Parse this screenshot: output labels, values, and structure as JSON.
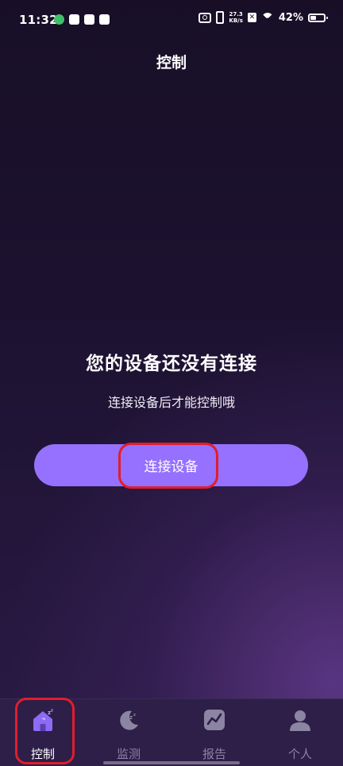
{
  "status_bar": {
    "time": "11:32",
    "net_speed_value": "27.3",
    "net_speed_unit": "KB/s",
    "sim_label": "✕",
    "battery": "42%"
  },
  "header": {
    "title": "控制"
  },
  "empty_state": {
    "title": "您的设备还没有连接",
    "subtitle": "连接设备后才能控制哦",
    "button_label": "连接设备"
  },
  "tabs": [
    {
      "label": "控制",
      "icon": "home-icon",
      "active": true
    },
    {
      "label": "监测",
      "icon": "moon-sleep-icon",
      "active": false
    },
    {
      "label": "报告",
      "icon": "chart-icon",
      "active": false
    },
    {
      "label": "个人",
      "icon": "person-icon",
      "active": false
    }
  ],
  "colors": {
    "accent": "#9670ff",
    "tab_active": "#8f6af5",
    "tab_inactive": "#8c84a3",
    "highlight": "#e01e2c"
  }
}
